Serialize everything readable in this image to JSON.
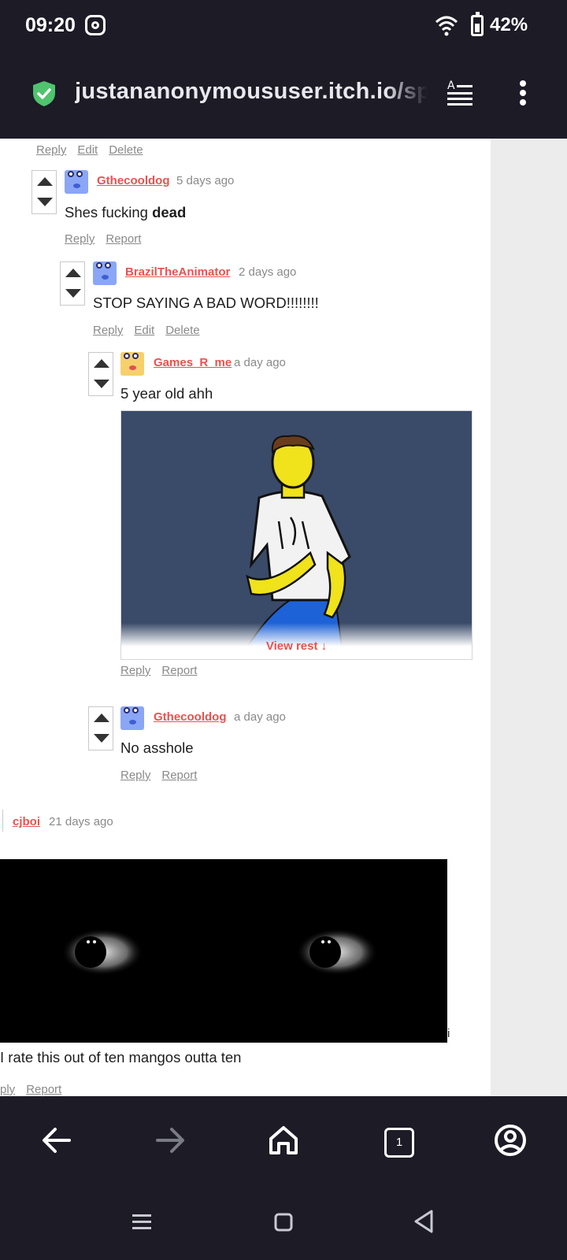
{
  "status": {
    "time": "09:20",
    "battery": "42%"
  },
  "browser": {
    "url": "justananonymoususer.itch.io/spruu",
    "tabs_count": "1"
  },
  "top_actions": [
    "Reply",
    "Edit",
    "Delete"
  ],
  "comments": [
    {
      "user": "Gthecooldog",
      "time": "5 days ago",
      "text_plain": "Shes fucking ",
      "text_bold": "dead",
      "actions": [
        "Reply",
        "Report"
      ]
    },
    {
      "user": "BrazilTheAnimator",
      "time": "2 days ago",
      "text": "STOP SAYING A BAD WORD!!!!!!!!",
      "actions": [
        "Reply",
        "Edit",
        "Delete"
      ]
    },
    {
      "user": "Games_R_me",
      "time": "a day ago",
      "text": "5 year old ahh",
      "view_rest": "View rest ↓",
      "actions": [
        "Reply",
        "Report"
      ]
    },
    {
      "user": "Gthecooldog",
      "time": "a day ago",
      "text": "No asshole",
      "actions": [
        "Reply",
        "Report"
      ]
    },
    {
      "user": "cjboi",
      "time": "21 days ago",
      "after_image": "i",
      "text": "I rate this out of ten mangos outta ten",
      "actions": [
        "ply",
        "Report"
      ]
    }
  ],
  "colors": {
    "accent": "#e8524f",
    "chrome": "#1c1b26",
    "shield": "#4fc36d"
  },
  "icons": [
    "shield-icon",
    "reader-view-icon",
    "more-vert-icon",
    "back-icon",
    "forward-icon",
    "home-icon",
    "tabs-icon",
    "account-icon",
    "recents-icon",
    "home-nav-icon",
    "back-nav-icon"
  ]
}
